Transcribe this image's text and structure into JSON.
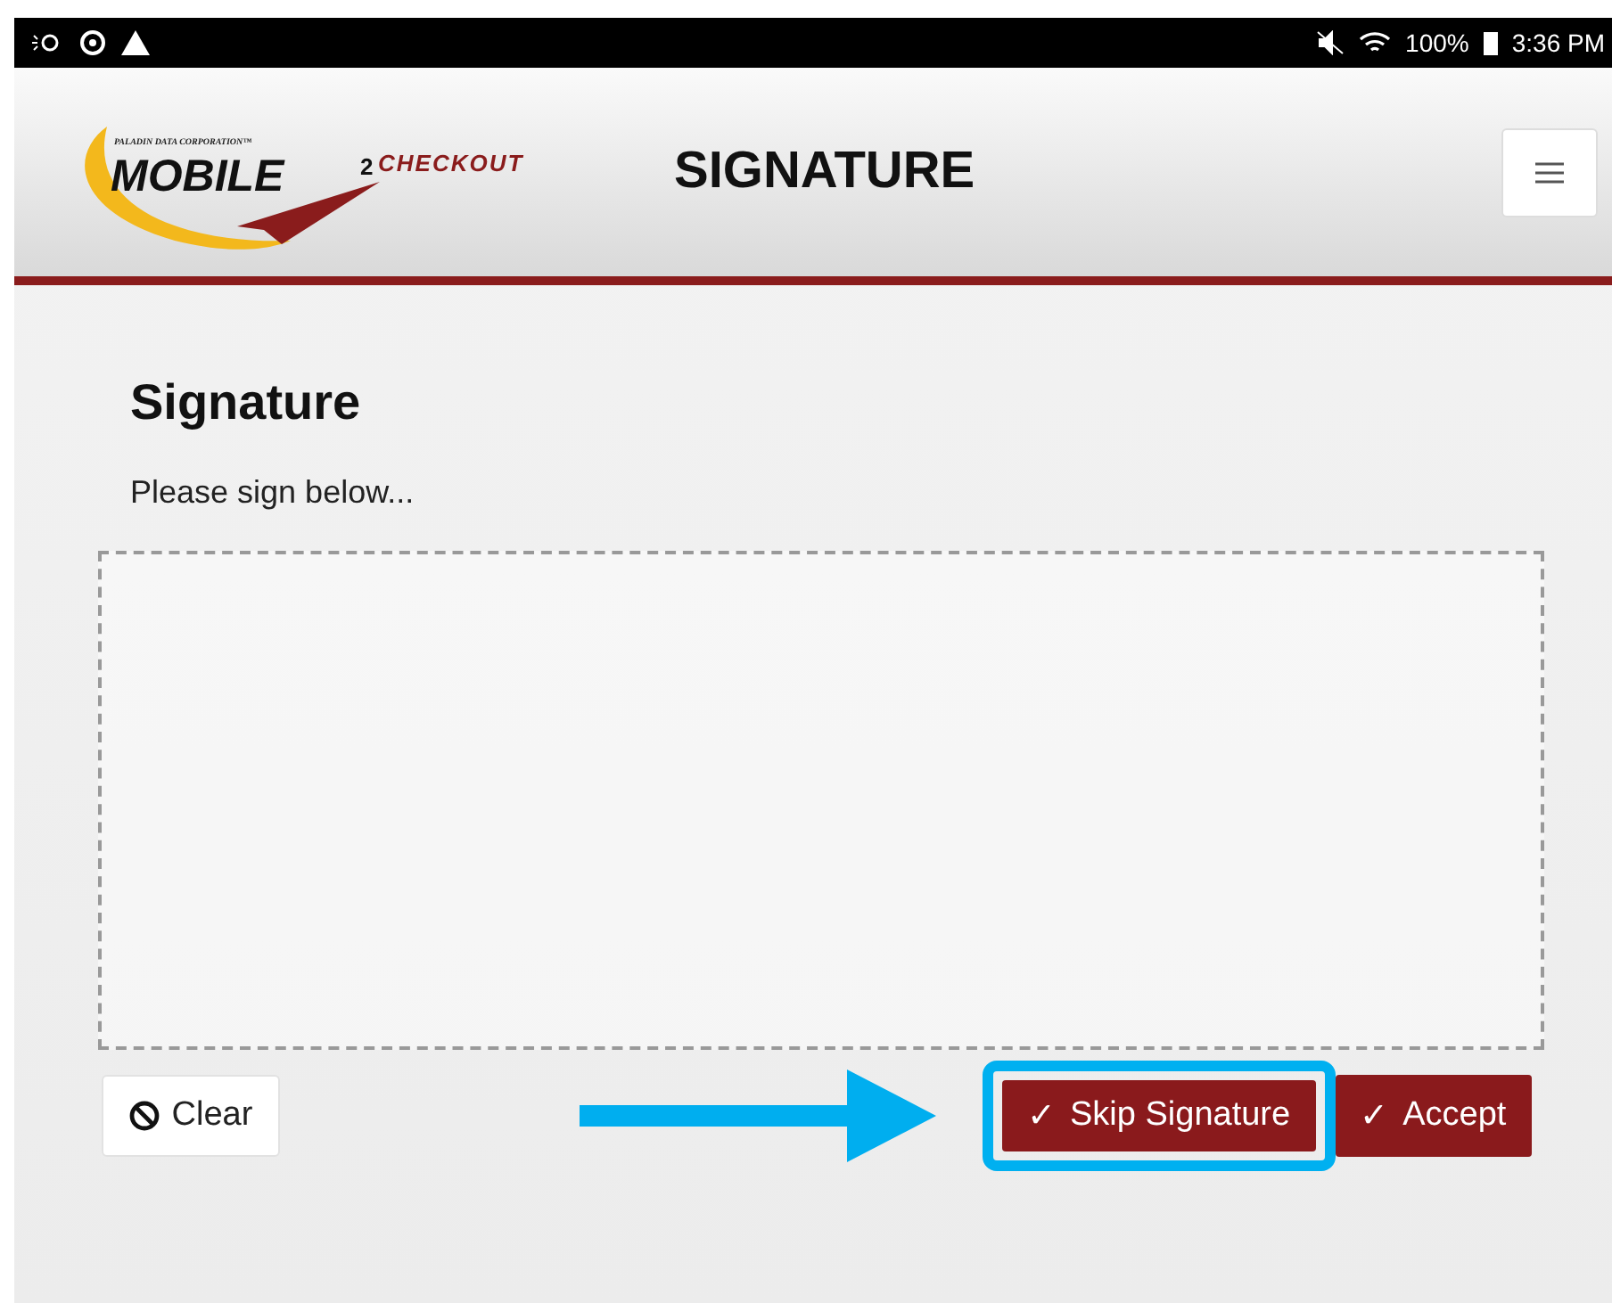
{
  "status_bar": {
    "battery": "100%",
    "time": "3:36 PM"
  },
  "header": {
    "logo": {
      "company": "PALADIN DATA CORPORATION™",
      "product": "MOBILE",
      "superscript": "2",
      "suffix": "CHECKOUT"
    },
    "title": "SIGNATURE"
  },
  "page": {
    "heading": "Signature",
    "instruction": "Please sign below..."
  },
  "buttons": [
    {
      "kind": "clear",
      "label": "Clear"
    },
    {
      "kind": "confirm",
      "label": "Skip Signature",
      "check": "✓",
      "highlighted": true
    },
    {
      "kind": "confirm",
      "label": "Accept",
      "check": "✓",
      "highlighted": false
    }
  ]
}
